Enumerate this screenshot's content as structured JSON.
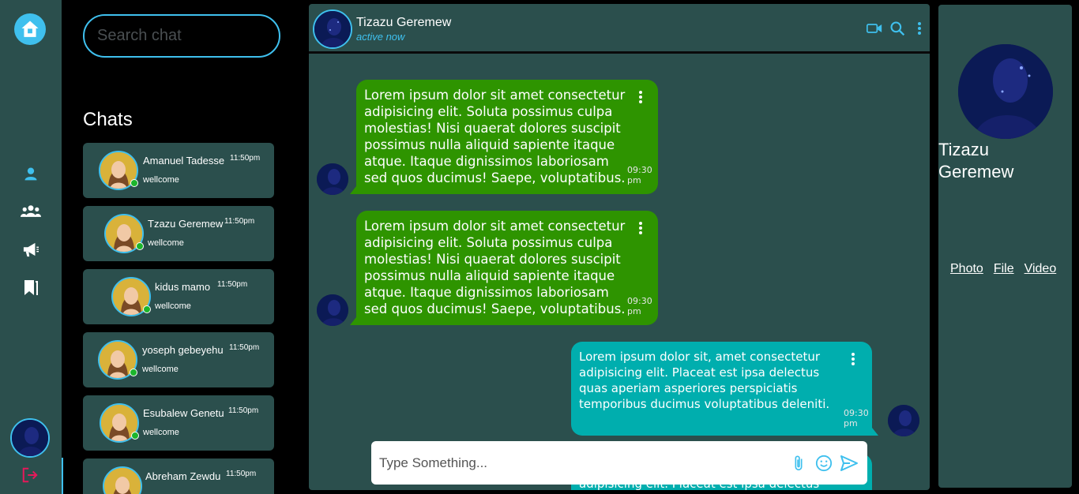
{
  "search": {
    "placeholder": "Search chat"
  },
  "chats_title": "Chats",
  "chat_list": [
    {
      "name": "Amanuel Tadesse",
      "time": "11:50pm",
      "message": "wellcome"
    },
    {
      "name": "Tzazu Geremew",
      "time": "11:50pm",
      "message": "wellcome"
    },
    {
      "name": "kidus mamo",
      "time": "11:50pm",
      "message": "wellcome"
    },
    {
      "name": "yoseph gebeyehu",
      "time": "11:50pm",
      "message": "wellcome"
    },
    {
      "name": "Esubalew Genetu",
      "time": "11:50pm",
      "message": "wellcome"
    },
    {
      "name": "Abreham Zewdu",
      "time": "11:50pm",
      "message": ""
    }
  ],
  "conversation": {
    "contact_name": "Tizazu Geremew",
    "status": "active now",
    "messages": [
      {
        "direction": "in",
        "text": "Lorem ipsum dolor sit amet consectetur adipisicing elit. Soluta possimus culpa molestias! Nisi quaerat dolores suscipit possimus nulla aliquid sapiente itaque atque. Itaque dignissimos laboriosam sed quos ducimus! Saepe, voluptatibus.",
        "time": "09:30 pm"
      },
      {
        "direction": "in",
        "text": "Lorem ipsum dolor sit amet consectetur adipisicing elit. Soluta possimus culpa molestias! Nisi quaerat dolores suscipit possimus nulla aliquid sapiente itaque atque. Itaque dignissimos laboriosam sed quos ducimus! Saepe, voluptatibus.",
        "time": "09:30 pm"
      },
      {
        "direction": "out",
        "text": "Lorem ipsum dolor sit, amet consectetur adipisicing elit. Placeat est ipsa delectus quas aperiam asperiores perspiciatis temporibus ducimus voluptatibus deleniti.",
        "time": "09:30 pm"
      },
      {
        "direction": "out",
        "text": "adipisicing elit. Placeat est ipsa delectus"
      }
    ],
    "composer_placeholder": "Type Something..."
  },
  "profile": {
    "name": "Tizazu Geremew",
    "tabs": [
      "Photo",
      "File",
      "Video"
    ]
  },
  "colors": {
    "accent": "#3fc0ee",
    "panel": "#2b4f4d",
    "incoming_bubble": "#2e9400",
    "outgoing_bubble": "#00aeae",
    "online": "#1cb52c",
    "logout": "#e5195a"
  },
  "icons": {
    "rail": [
      "home-icon",
      "user-icon",
      "group-icon",
      "megaphone-icon",
      "bookmarks-icon",
      "logout-icon"
    ],
    "header": [
      "video-call-icon",
      "search-icon",
      "more-vertical-icon"
    ],
    "composer": [
      "paperclip-icon",
      "emoji-icon",
      "send-icon"
    ]
  }
}
